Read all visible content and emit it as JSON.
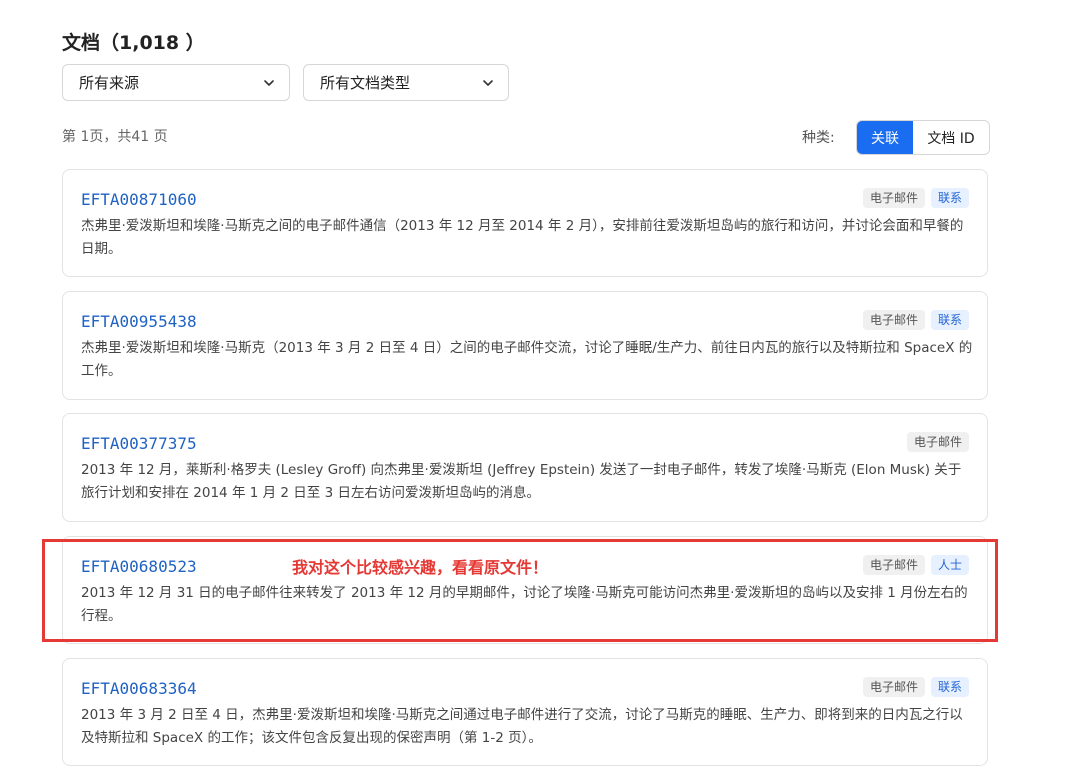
{
  "header": {
    "title": "文档（1,018 ）"
  },
  "filters": {
    "source": {
      "value": "所有来源",
      "icon": "chevron-down-icon"
    },
    "doc_type": {
      "value": "所有文档类型",
      "icon": "chevron-down-icon"
    }
  },
  "pagination": {
    "text": "第 1页，共41 页"
  },
  "kind": {
    "label": "种类:",
    "options": [
      "关联",
      "文档 ID"
    ],
    "selected": "关联"
  },
  "results": [
    {
      "id": "EFTA00871060",
      "description": "杰弗里·爱泼斯坦和埃隆·马斯克之间的电子邮件通信（2013 年 12 月至 2014 年 2 月），安排前往爱泼斯坦岛屿的旅行和访问，并讨论会面和早餐的日期。",
      "tags": [
        "电子邮件",
        "联系"
      ]
    },
    {
      "id": "EFTA00955438",
      "description": "杰弗里·爱泼斯坦和埃隆·马斯克（2013 年 3 月 2 日至 4 日）之间的电子邮件交流，讨论了睡眠/生产力、前往日内瓦的旅行以及特斯拉和 SpaceX 的工作。",
      "tags": [
        "电子邮件",
        "联系"
      ]
    },
    {
      "id": "EFTA00377375",
      "description": "2013 年 12 月，莱斯利·格罗夫 (Lesley Groff) 向杰弗里·爱泼斯坦 (Jeffrey Epstein) 发送了一封电子邮件，转发了埃隆·马斯克 (Elon Musk) 关于旅行计划和安排在 2014 年 1 月 2 日至 3 日左右访问爱泼斯坦岛屿的消息。",
      "tags": [
        "电子邮件"
      ]
    },
    {
      "id": "EFTA00680523",
      "description": "2013 年 12 月 31 日的电子邮件往来转发了 2013 年 12 月的早期邮件，讨论了埃隆·马斯克可能访问杰弗里·爱泼斯坦的岛屿以及安排 1 月份左右的行程。",
      "tags": [
        "电子邮件",
        "人士"
      ]
    },
    {
      "id": "EFTA00683364",
      "description": "2013 年 3 月 2 日至 4 日，杰弗里·爱泼斯坦和埃隆·马斯克之间通过电子邮件进行了交流，讨论了马斯克的睡眠、生产力、即将到来的日内瓦之行以及特斯拉和 SpaceX 的工作；该文件包含反复出现的保密声明（第 1-2 页）。",
      "tags": [
        "电子邮件",
        "联系"
      ]
    }
  ],
  "annotation": {
    "text": "我对这个比较感兴趣，看看原文件！",
    "color": "#e53935"
  },
  "colors": {
    "accent": "#1a6cf0",
    "link": "#1f62c4",
    "tag_blue_bg": "#e6f0ff"
  }
}
